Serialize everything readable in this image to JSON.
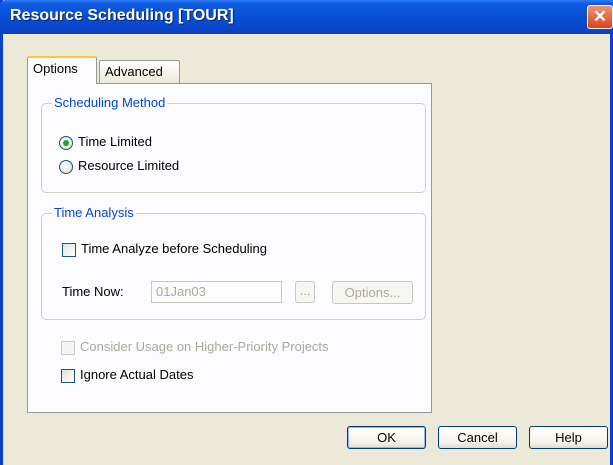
{
  "window": {
    "title": "Resource Scheduling [TOUR]",
    "close_glyph": "✕"
  },
  "tabs": [
    {
      "label": "Options",
      "active": true
    },
    {
      "label": "Advanced",
      "active": false
    }
  ],
  "scheduling_method": {
    "legend": "Scheduling Method",
    "options": [
      {
        "label": "Time Limited",
        "selected": true
      },
      {
        "label": "Resource Limited",
        "selected": false
      }
    ]
  },
  "time_analysis": {
    "legend": "Time Analysis",
    "time_analyze_label": "Time Analyze before Scheduling",
    "time_now_label": "Time Now:",
    "time_now_value": "01Jan03",
    "browse_label": "...",
    "options_button": "Options..."
  },
  "checkboxes": {
    "consider_usage": "Consider Usage on Higher-Priority Projects",
    "ignore_actual": "Ignore Actual Dates"
  },
  "buttons": {
    "ok": "OK",
    "cancel": "Cancel",
    "help": "Help"
  },
  "colors": {
    "title_bar": "#0a4fd4",
    "legend_text": "#0046d5",
    "radio_selected": "#21a121",
    "active_tab_accent": "#ffc83c"
  }
}
